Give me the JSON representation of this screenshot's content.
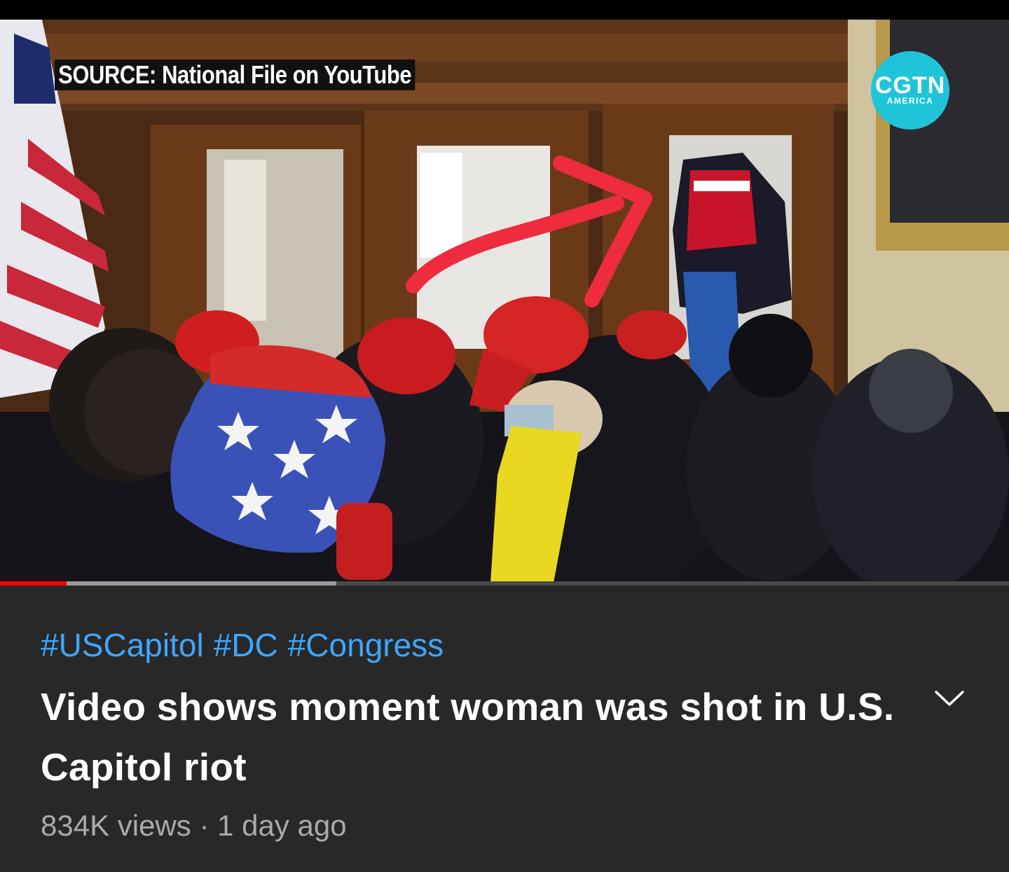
{
  "video": {
    "source_overlay": "SOURCE: National File on YouTube",
    "channel_logo": {
      "name": "CGTN",
      "sub": "AMERICA",
      "color": "#20c4d8"
    },
    "progress": {
      "played_fraction": 0.066,
      "buffered_fraction": 0.333,
      "played_color": "#ff0000"
    }
  },
  "info": {
    "hashtags": [
      "#USCapitol",
      "#DC",
      "#Congress"
    ],
    "title": "Video shows moment woman was shot in U.S. Capitol riot",
    "views": "834K views",
    "separator": "·",
    "age": "1 day ago",
    "expand_icon": "chevron-down-icon",
    "hashtag_color": "#3ea6ff"
  }
}
